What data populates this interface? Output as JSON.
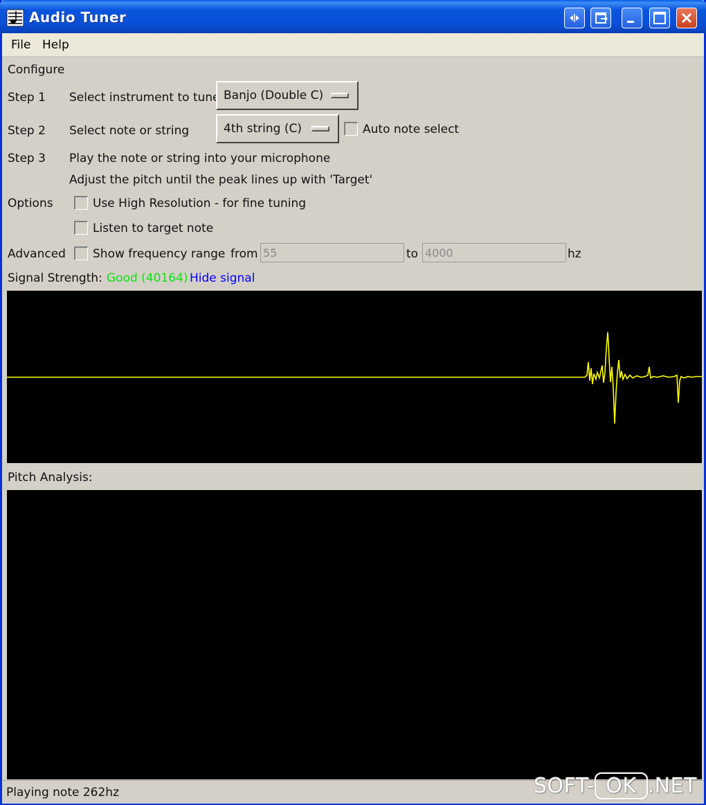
{
  "window": {
    "title": "Audio Tuner",
    "colors": {
      "titlebar": "#0a55dd",
      "panel": "#d4d0c8",
      "signal_good": "#10e010",
      "link": "#0000ff",
      "waveform": "#ffff00",
      "scope_bg": "#000000"
    }
  },
  "titlebar_buttons": [
    "arrows-icon",
    "restore-icon",
    "minimize-icon",
    "maximize-icon",
    "close-icon"
  ],
  "menu": {
    "file": "File",
    "help": "Help"
  },
  "configure": {
    "heading": "Configure",
    "step1": {
      "label": "Step 1",
      "text": "Select instrument to tune",
      "value": "Banjo (Double C)"
    },
    "step2": {
      "label": "Step 2",
      "text": "Select note or string",
      "value": "4th string (C)",
      "auto_label": "Auto note select",
      "auto_checked": false
    },
    "step3": {
      "label": "Step 3",
      "line1": "Play the note or string into your microphone",
      "line2": "Adjust the pitch until the peak lines up with 'Target'"
    }
  },
  "options": {
    "label": "Options",
    "high_res": "Use High Resolution - for fine tuning",
    "high_res_checked": false,
    "listen": "Listen to target note",
    "listen_checked": false
  },
  "advanced": {
    "label": "Advanced",
    "show_range": "Show frequency range",
    "show_range_checked": false,
    "from_label": "from",
    "from_value": "55",
    "to_label": "to",
    "to_value": "4000",
    "unit": "hz"
  },
  "signal": {
    "label": "Signal Strength:",
    "value": "Good (40164)",
    "hide_link": "Hide signal"
  },
  "pitch": {
    "label": "Pitch Analysis:"
  },
  "status": {
    "text": "Playing note 262hz"
  },
  "watermark": {
    "left": "SOFT-",
    "box": "OK",
    "right": ".NET"
  }
}
